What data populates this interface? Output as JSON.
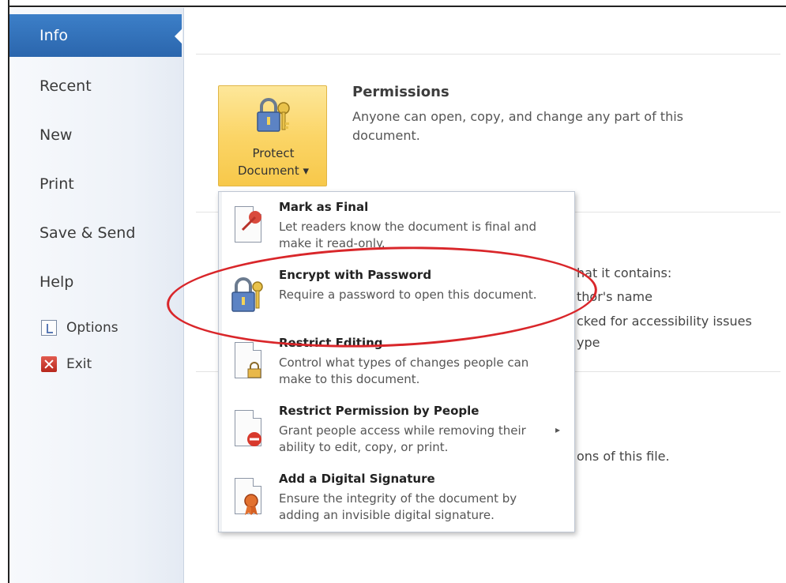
{
  "sidebar": {
    "items": [
      {
        "label": "Info"
      },
      {
        "label": "Recent"
      },
      {
        "label": "New"
      },
      {
        "label": "Print"
      },
      {
        "label": "Save & Send"
      },
      {
        "label": "Help"
      }
    ],
    "options_label": "Options",
    "exit_label": "Exit"
  },
  "protect": {
    "label_line1": "Protect",
    "label_line2": "Document ▾"
  },
  "permissions": {
    "title": "Permissions",
    "description": "Anyone can open, copy, and change any part of this document."
  },
  "background_fragments": {
    "contains": "hat it contains:",
    "author": "thor's name",
    "accessibility": "cked for accessibility issues",
    "type": "ype",
    "versions": "ons of this file."
  },
  "menu": {
    "items": [
      {
        "title": "Mark as Final",
        "desc": "Let readers know the document is final and make it read-only.",
        "icon": "mark-final-icon"
      },
      {
        "title": "Encrypt with Password",
        "desc": "Require a password to open this document.",
        "icon": "lock-icon"
      },
      {
        "title": "Restrict Editing",
        "desc": "Control what types of changes people can make to this document.",
        "icon": "restrict-editing-icon"
      },
      {
        "title": "Restrict Permission by People",
        "desc": "Grant people access while removing their ability to edit, copy, or print.",
        "icon": "restrict-permission-icon",
        "submenu_arrow": "▸"
      },
      {
        "title": "Add a Digital Signature",
        "desc": "Ensure the integrity of the document by adding an invisible digital signature.",
        "icon": "digital-signature-icon"
      }
    ]
  },
  "colors": {
    "active_nav": "#2b66ad",
    "protect_button": "#fbd567",
    "highlight_ellipse": "#d9262a"
  }
}
